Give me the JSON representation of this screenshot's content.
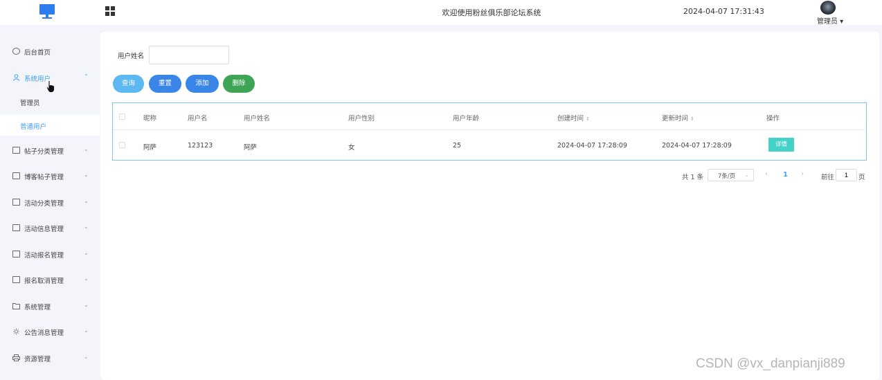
{
  "header": {
    "title": "欢迎使用粉丝俱乐部论坛系统",
    "datetime": "2024-04-07 17:31:43",
    "user": "管理员 ▾"
  },
  "sidebar": {
    "items": [
      {
        "label": "后台首页",
        "icon": "clock-icon"
      },
      {
        "label": "系统用户",
        "icon": "user-icon",
        "active": true,
        "expanded": true
      },
      {
        "label": "帖子分类管理",
        "icon": "card-icon"
      },
      {
        "label": "博客帖子管理",
        "icon": "card-icon"
      },
      {
        "label": "活动分类管理",
        "icon": "card-icon"
      },
      {
        "label": "活动信息管理",
        "icon": "card-icon"
      },
      {
        "label": "活动报名管理",
        "icon": "card-icon"
      },
      {
        "label": "报名取消管理",
        "icon": "card-icon"
      },
      {
        "label": "系统管理",
        "icon": "folder-icon"
      },
      {
        "label": "公告消息管理",
        "icon": "gear-icon"
      },
      {
        "label": "资源管理",
        "icon": "printer-icon"
      }
    ],
    "sub_items": [
      {
        "label": "管理员"
      },
      {
        "label": "普通用户",
        "active": true
      }
    ],
    "expanded_arrow": "⌃",
    "collapsed_arrow": "⌄"
  },
  "search": {
    "label": "用户姓名",
    "value": "",
    "placeholder": ""
  },
  "buttons": {
    "query": "查询",
    "reset": "重置",
    "add": "添加",
    "delete": "删除"
  },
  "table": {
    "headers": {
      "nickname": "昵称",
      "username": "用户名",
      "realname": "用户姓名",
      "gender": "用户性别",
      "age": "用户年龄",
      "created": "创建时间",
      "updated": "更新时间",
      "actions": "操作"
    },
    "sort_glyph": "⇕",
    "rows": [
      {
        "nickname": "阿萨",
        "username": "123123",
        "realname": "阿萨",
        "gender": "女",
        "age": "25",
        "created": "2024-04-07 17:28:09",
        "updated": "2024-04-07 17:28:09",
        "action_label": "详情"
      }
    ]
  },
  "pagination": {
    "total": "共 1 条",
    "page_size": "7条/页",
    "prev": "‹",
    "current": "1",
    "next": "›",
    "goto_label": "前往",
    "goto_value": "1",
    "unit": "页"
  },
  "watermark": "CSDN @vx_danpianji889",
  "colors": {
    "accent": "#409eff",
    "query_button": "#5cb8f0",
    "primary_button": "#3a86e8",
    "delete_button": "#3fa556",
    "detail_button": "#44d2c8",
    "logo": "#2d7cf0"
  }
}
